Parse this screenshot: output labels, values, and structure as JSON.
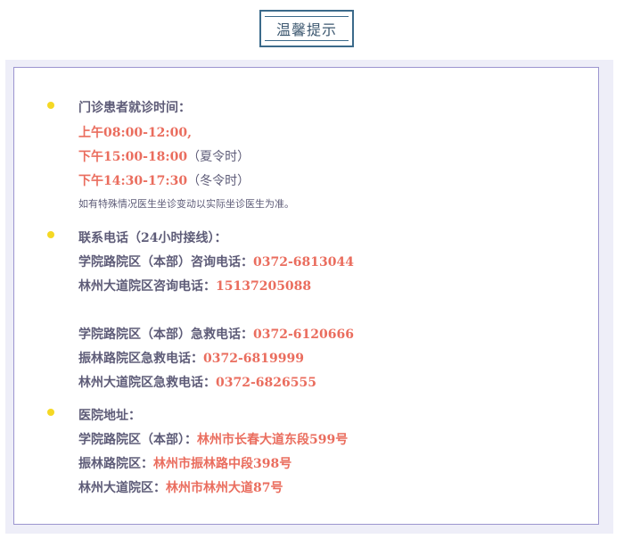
{
  "title": "温馨提示",
  "sections": [
    {
      "heading": "门诊患者就诊时间：",
      "lines": [
        {
          "value": "上午08:00-12:00,",
          "suffix": ""
        },
        {
          "value": "下午15:00-18:00",
          "suffix": "（夏令时）"
        },
        {
          "value": "下午14:30-17:30",
          "suffix": "（冬令时）"
        }
      ],
      "note": "如有特殊情况医生坐诊变动以实际坐诊医生为准。"
    },
    {
      "heading": "联系电话（24小时接线）：",
      "lines": [
        {
          "label": "学院路院区（本部）咨询电话：",
          "value": "0372-6813044"
        },
        {
          "label": "林州大道院区咨询电话：",
          "value": "15137205088"
        },
        {
          "label": "学院路院区（本部）急救电话：",
          "value": "0372-6120666"
        },
        {
          "label": "振林路院区急救电话：",
          "value": "0372-6819999"
        },
        {
          "label": "林州大道院区急救电话：",
          "value": "0372-6826555"
        }
      ]
    },
    {
      "heading": "医院地址：",
      "lines": [
        {
          "label": "学院路院区（本部）：",
          "value": "林州市长春大道东段599号"
        },
        {
          "label": "振林路院区：",
          "value": "林州市振林路中段398号"
        },
        {
          "label": "林州大道院区：",
          "value": "林州市林州大道87号"
        }
      ]
    }
  ],
  "colors": {
    "accent_red": "#ea6d5e",
    "text": "#5e5c78",
    "bullet": "#f5d824",
    "border": "#9c95cf",
    "title_border": "#3b6a8a"
  }
}
